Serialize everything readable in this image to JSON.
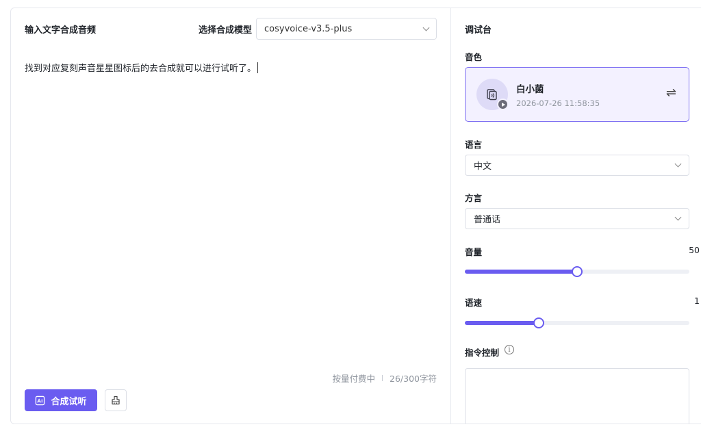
{
  "left": {
    "title": "输入文字合成音频",
    "model_label": "选择合成模型",
    "model_value": "cosyvoice-v3.5-plus",
    "text": "找到对应复刻声音星星图标后的去合成就可以进行试听了。",
    "billing": "按量付费中",
    "char_count": "26/300字符",
    "synthesize_label": "合成试听"
  },
  "right": {
    "title": "调试台",
    "voice_label": "音色",
    "voice": {
      "name": "白小菌",
      "time": "2026-07-26 11:58:35"
    },
    "language_label": "语言",
    "language_value": "中文",
    "dialect_label": "方言",
    "dialect_value": "普通话",
    "volume_label": "音量",
    "volume_value": "50",
    "volume_fraction": 0.5,
    "speed_label": "语速",
    "speed_value": "1",
    "speed_fraction": 0.33,
    "instruction_label": "指令控制"
  },
  "colors": {
    "accent": "#6a5cf0",
    "voice_card_bg": "#f3f1ff",
    "voice_card_border": "#7d6ff2"
  },
  "icons": [
    "chevron-down-icon",
    "ai-image-icon",
    "eraser-icon",
    "voice-clone-icon",
    "play-icon",
    "swap-icon",
    "info-icon"
  ]
}
